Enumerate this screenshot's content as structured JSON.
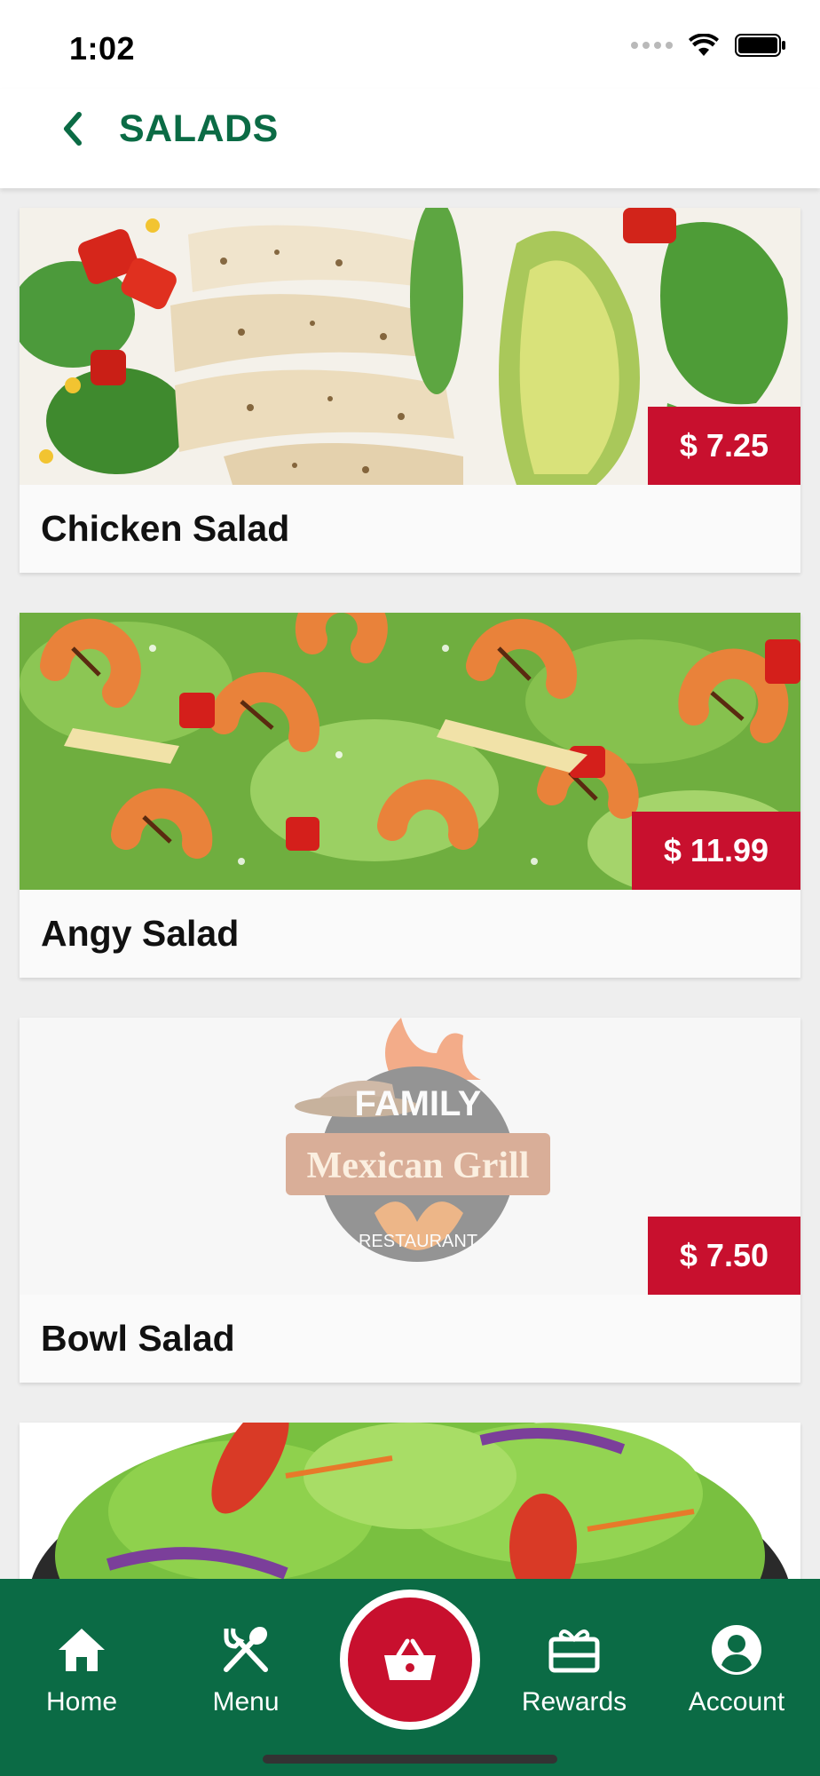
{
  "status_bar": {
    "time": "1:02"
  },
  "header": {
    "title": "SALADS"
  },
  "items": [
    {
      "name": "Chicken Salad",
      "price": "$ 7.25"
    },
    {
      "name": "Angy Salad",
      "price": "$ 11.99"
    },
    {
      "name": "Bowl Salad",
      "price": "$ 7.50",
      "placeholder_logo": {
        "line1": "FAMILY",
        "line2": "Mexican Grill",
        "line3": "RESTAURANT"
      }
    },
    {
      "name": "",
      "price": ""
    }
  ],
  "bottom_nav": {
    "home": "Home",
    "menu": "Menu",
    "cart_icon": "basket-icon",
    "rewards": "Rewards",
    "account": "Account"
  },
  "colors": {
    "brand_green": "#0b6b45",
    "price_red": "#c8102e"
  }
}
